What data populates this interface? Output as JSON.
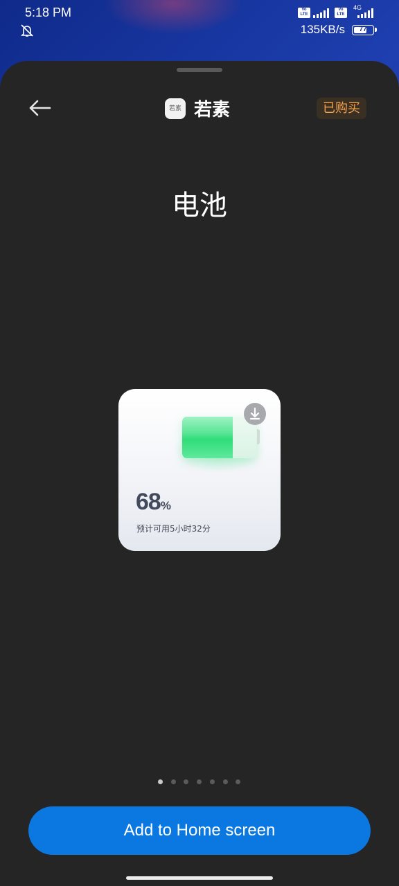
{
  "status_bar": {
    "time": "5:18 PM",
    "network_speed": "135KB/s",
    "battery_level": "77",
    "network_type": "4G",
    "volte_label": "Vo LTE",
    "icons": [
      "mute-icon",
      "volte-icon",
      "signal-icon",
      "battery-icon"
    ]
  },
  "header": {
    "back_icon": "arrow-left-icon",
    "app_icon_text": "若素",
    "app_name": "若素",
    "purchased_label": "已购买"
  },
  "widget": {
    "title": "电池",
    "percent_value": "68",
    "percent_unit": "%",
    "battery_fill_fraction": 0.68,
    "remaining_text": "预计可用5小时32分",
    "download_icon": "download-icon",
    "colors": {
      "battery_green": "#2fdd78",
      "text": "#434a5c"
    }
  },
  "pager": {
    "count": 7,
    "active_index": 0
  },
  "footer": {
    "add_button_label": "Add to Home screen",
    "accent_color": "#0a78e0"
  }
}
